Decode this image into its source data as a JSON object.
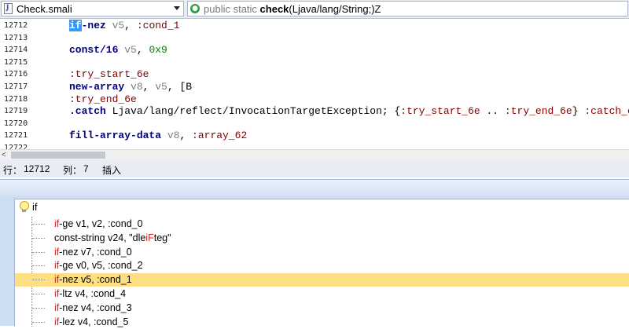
{
  "header": {
    "file_name": "Check.smali",
    "method_modifiers": "public static",
    "method_name": "check",
    "method_params": "(Ljava/lang/String;)Z"
  },
  "editor": {
    "lines": [
      {
        "num": "12712",
        "parts": [
          {
            "t": "if",
            "c": "sel"
          },
          {
            "t": "-nez",
            "c": "kw"
          },
          {
            "t": " v5",
            "c": "reg"
          },
          {
            "t": ", ",
            "c": "plain"
          },
          {
            "t": ":cond_1",
            "c": "lbl"
          }
        ]
      },
      {
        "num": "12713",
        "parts": []
      },
      {
        "num": "12714",
        "parts": [
          {
            "t": "const/16",
            "c": "kw"
          },
          {
            "t": " v5",
            "c": "reg"
          },
          {
            "t": ", ",
            "c": "plain"
          },
          {
            "t": "0x9",
            "c": "hex"
          }
        ]
      },
      {
        "num": "12715",
        "parts": []
      },
      {
        "num": "12716",
        "parts": [
          {
            "t": ":try_start_6e",
            "c": "lbl"
          }
        ]
      },
      {
        "num": "12717",
        "parts": [
          {
            "t": "new-array",
            "c": "kw"
          },
          {
            "t": " v8",
            "c": "reg"
          },
          {
            "t": ", ",
            "c": "plain"
          },
          {
            "t": "v5",
            "c": "reg"
          },
          {
            "t": ", [B",
            "c": "plain"
          }
        ]
      },
      {
        "num": "12718",
        "parts": [
          {
            "t": ":try_end_6e",
            "c": "lbl"
          }
        ]
      },
      {
        "num": "12719",
        "parts": [
          {
            "t": ".catch",
            "c": "kw"
          },
          {
            "t": " Ljava/lang/reflect/InvocationTargetException; {",
            "c": "plain"
          },
          {
            "t": ":try_start_6e",
            "c": "lbl"
          },
          {
            "t": " .. ",
            "c": "plain"
          },
          {
            "t": ":try_end_6e",
            "c": "lbl"
          },
          {
            "t": "} ",
            "c": "plain"
          },
          {
            "t": ":catch_e",
            "c": "lbl"
          }
        ]
      },
      {
        "num": "12720",
        "parts": []
      },
      {
        "num": "12721",
        "parts": [
          {
            "t": "fill-array-data",
            "c": "kw"
          },
          {
            "t": " v8",
            "c": "reg"
          },
          {
            "t": ", ",
            "c": "plain"
          },
          {
            "t": ":array_62",
            "c": "lbl"
          }
        ]
      },
      {
        "num": "12722",
        "parts": []
      }
    ]
  },
  "status": {
    "line_label": "行：",
    "line_value": "12712",
    "col_label": "列：",
    "col_value": "7",
    "mode": "插入"
  },
  "search": {
    "root_label": "if",
    "results": [
      {
        "pre": "",
        "kw": "if",
        "post": "-ge v1, v2, :cond_0",
        "highlight": false
      },
      {
        "pre": "const-string v24, \"dle",
        "kw": "iF",
        "post": "teg\"",
        "highlight": false
      },
      {
        "pre": "",
        "kw": "if",
        "post": "-nez v7, :cond_0",
        "highlight": false
      },
      {
        "pre": "",
        "kw": "if",
        "post": "-ge v0, v5, :cond_2",
        "highlight": false
      },
      {
        "pre": "",
        "kw": "if",
        "post": "-nez v5, :cond_1",
        "highlight": true
      },
      {
        "pre": "",
        "kw": "if",
        "post": "-ltz v4, :cond_4",
        "highlight": false
      },
      {
        "pre": "",
        "kw": "if",
        "post": "-nez v4, :cond_3",
        "highlight": false
      },
      {
        "pre": "",
        "kw": "if",
        "post": "-lez v4, :cond_5",
        "highlight": false
      }
    ]
  },
  "colors": {
    "selection": "#3399ff",
    "highlight_row": "#fddf82",
    "keyword_match": "#e02020",
    "panel_bg": "#cfdff3"
  }
}
